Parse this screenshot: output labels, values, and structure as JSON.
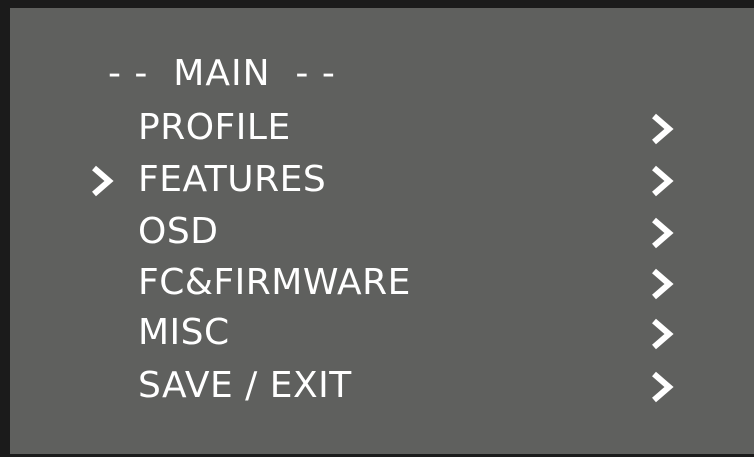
{
  "menu": {
    "title": "- -  MAIN  - -",
    "selected_index": 1,
    "items": [
      {
        "label": "PROFILE",
        "arrow_icon": "chevron-right-icon"
      },
      {
        "label": "FEATURES",
        "arrow_icon": "chevron-right-icon"
      },
      {
        "label": "OSD",
        "arrow_icon": "chevron-right-icon"
      },
      {
        "label": "FC&FIRMWARE",
        "arrow_icon": "chevron-right-icon"
      },
      {
        "label": "MISC",
        "arrow_icon": "chevron-right-icon"
      },
      {
        "label": "SAVE / EXIT",
        "arrow_icon": "chevron-right-icon"
      }
    ],
    "cursor_icon": "chevron-right-icon"
  },
  "colors": {
    "background": "#5f605e",
    "frame": "#1b1b1b",
    "text": "#ffffff"
  }
}
